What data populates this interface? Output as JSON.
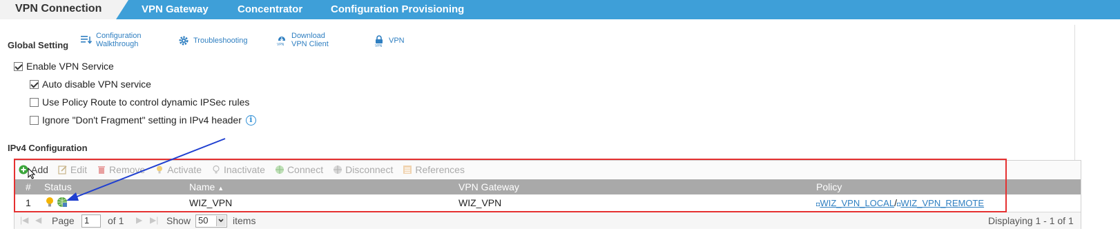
{
  "tabs": {
    "active": "VPN Connection",
    "items": [
      "VPN Gateway",
      "Concentrator",
      "Configuration Provisioning"
    ]
  },
  "global": {
    "title": "Global Setting",
    "links": {
      "walkthrough_l1": "Configuration",
      "walkthrough_l2": "Walkthrough",
      "troubleshooting": "Troubleshooting",
      "download_l1": "Download",
      "download_l2": "VPN Client",
      "vpn": "VPN"
    }
  },
  "options": {
    "enable_vpn": {
      "label": "Enable VPN Service",
      "checked": true
    },
    "auto_disable": {
      "label": "Auto disable VPN service",
      "checked": true
    },
    "policy_route": {
      "label": "Use Policy Route to control dynamic IPSec rules",
      "checked": false
    },
    "ignore_df": {
      "label": "Ignore \"Don't Fragment\" setting in IPv4 header",
      "checked": false
    }
  },
  "ipv4": {
    "title": "IPv4 Configuration",
    "toolbar": {
      "add": "Add",
      "edit": "Edit",
      "remove": "Remove",
      "activate": "Activate",
      "inactivate": "Inactivate",
      "connect": "Connect",
      "disconnect": "Disconnect",
      "references": "References"
    },
    "columns": {
      "num": "#",
      "status": "Status",
      "name": "Name",
      "gateway": "VPN Gateway",
      "policy": "Policy"
    },
    "rows": [
      {
        "num": "1",
        "name": "WIZ_VPN",
        "gateway": "WIZ_VPN",
        "policy_local": "WIZ_VPN_LOCAL",
        "sep": "/",
        "policy_remote": "WIZ_VPN_REMOTE"
      }
    ],
    "pager": {
      "page_label": "Page",
      "page": "1",
      "of": "of 1",
      "show_label": "Show",
      "page_size": "50",
      "items_label": "items",
      "displaying": "Displaying 1 - 1 of 1"
    }
  },
  "colors": {
    "tab_bar": "#3e9fd8",
    "link": "#2f7fc1",
    "highlight_frame": "#e53030",
    "arrow": "#1f3fd0"
  }
}
